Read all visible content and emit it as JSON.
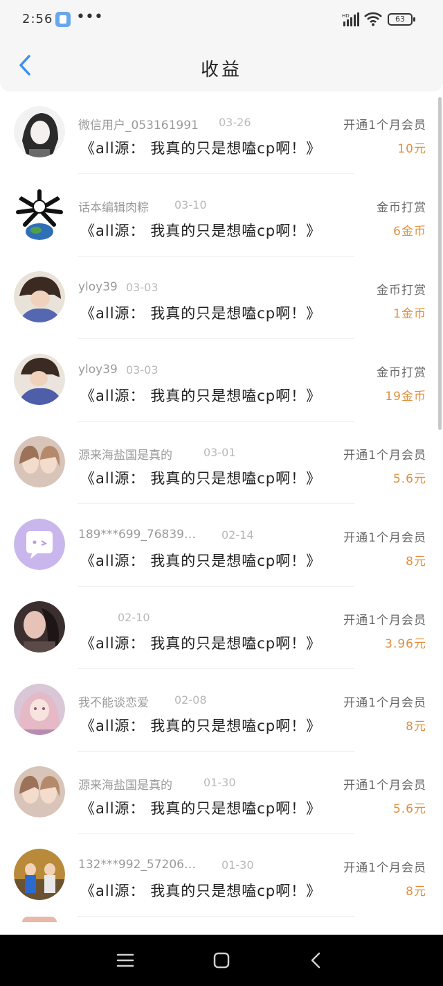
{
  "status_bar": {
    "time": "2:56",
    "battery": "63",
    "network": "HD"
  },
  "header": {
    "title": "收益"
  },
  "items": [
    {
      "name": "微信用户_053161991",
      "date": "03-26",
      "work": "《all源： 我真的只是想嗑cp啊！》",
      "type": "开通1个月会员",
      "amount": "10元",
      "avatar_color": "#3a3a3a"
    },
    {
      "name": "话本编辑肉粽",
      "date": "03-10",
      "work": "《all源： 我真的只是想嗑cp啊！》",
      "type": "金币打赏",
      "amount": "6金币",
      "avatar_color": "#2b5e9e"
    },
    {
      "name": "yloy39",
      "date": "03-03",
      "work": "《all源： 我真的只是想嗑cp啊！》",
      "type": "金币打赏",
      "amount": "1金币",
      "avatar_color": "#6a5a55"
    },
    {
      "name": "yloy39",
      "date": "03-03",
      "work": "《all源： 我真的只是想嗑cp啊！》",
      "type": "金币打赏",
      "amount": "19金币",
      "avatar_color": "#5a5a7a"
    },
    {
      "name": "源来海盐国是真的",
      "date": "03-01",
      "work": "《all源： 我真的只是想嗑cp啊！》",
      "type": "开通1个月会员",
      "amount": "5.6元",
      "avatar_color": "#b8918a"
    },
    {
      "name": "189***699_768394…",
      "date": "02-14",
      "work": "《all源： 我真的只是想嗑cp啊！》",
      "type": "开通1个月会员",
      "amount": "8元",
      "avatar_color": "#c9b6ec"
    },
    {
      "name": "",
      "date": "02-10",
      "work": "《all源： 我真的只是想嗑cp啊！》",
      "type": "开通1个月会员",
      "amount": "3.96元",
      "avatar_color": "#4a3a3a"
    },
    {
      "name": "我不能谈恋爱",
      "date": "02-08",
      "work": "《all源： 我真的只是想嗑cp啊！》",
      "type": "开通1个月会员",
      "amount": "8元",
      "avatar_color": "#c9a9b9"
    },
    {
      "name": "源来海盐国是真的",
      "date": "01-30",
      "work": "《all源： 我真的只是想嗑cp啊！》",
      "type": "开通1个月会员",
      "amount": "5.6元",
      "avatar_color": "#b8918a"
    },
    {
      "name": "132***992_572062…",
      "date": "01-30",
      "work": "《all源： 我真的只是想嗑cp啊！》",
      "type": "开通1个月会员",
      "amount": "8元",
      "avatar_color": "#8a6a30"
    }
  ]
}
